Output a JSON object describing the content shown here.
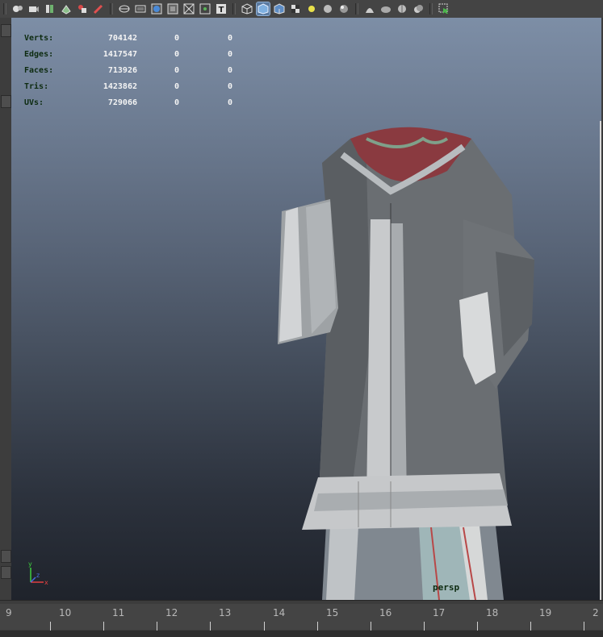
{
  "toolbar": {
    "icons": [
      "camera-icon",
      "camera-attributes-icon",
      "bookmark-icon",
      "image-plane-icon",
      "grease-pencil-icon",
      "pen-icon",
      "wireframe-icon",
      "film-gate-icon",
      "resolution-gate-icon",
      "safe-action-icon",
      "gate-mask-icon",
      "field-chart-icon",
      "text-icon",
      "wireframe-cube-icon",
      "smooth-shade-cube-icon",
      "wireframe-on-shaded-icon",
      "checker-texture-icon",
      "use-default-light-icon",
      "shadows-icon",
      "screen-space-ao-icon",
      "isolate-select-icon",
      "motion-blur-icon",
      "anti-aliasing-icon",
      "depth-of-field-icon",
      "xray-icon"
    ]
  },
  "hud": {
    "rows": [
      {
        "label": "Verts:",
        "total": "704142",
        "selected": "0",
        "tris": "0"
      },
      {
        "label": "Edges:",
        "total": "1417547",
        "selected": "0",
        "tris": "0"
      },
      {
        "label": "Faces:",
        "total": "713926",
        "selected": "0",
        "tris": "0"
      },
      {
        "label": "Tris:",
        "total": "1423862",
        "selected": "0",
        "tris": "0"
      },
      {
        "label": "UVs:",
        "total": "729066",
        "selected": "0",
        "tris": "0"
      }
    ]
  },
  "viewport": {
    "camera_label": "persp"
  },
  "axis": {
    "x": "x",
    "y": "y",
    "z": "z"
  },
  "timeline": {
    "ticks": [
      "9",
      "10",
      "11",
      "12",
      "13",
      "14",
      "15",
      "16",
      "17",
      "18",
      "19",
      "2"
    ]
  }
}
